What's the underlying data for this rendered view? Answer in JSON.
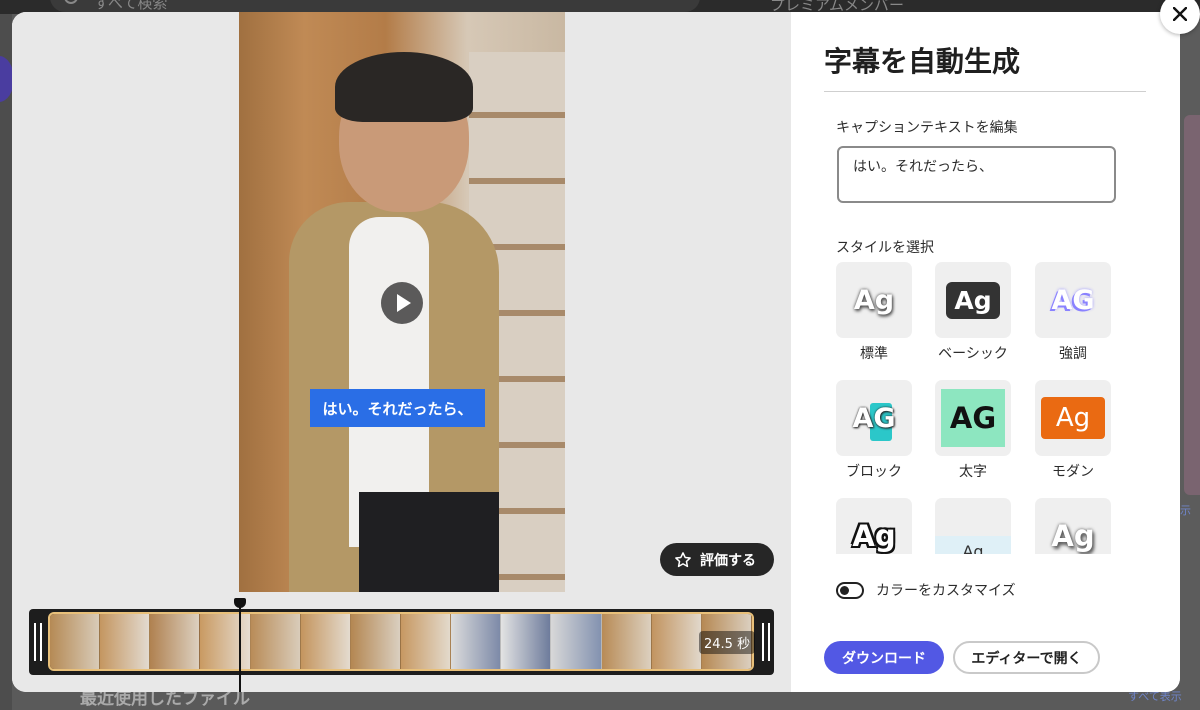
{
  "background": {
    "search_placeholder": "すべて検索",
    "premium_label": "プレミアムメンバー",
    "recent_files_heading": "最近使用したファイル",
    "show_all_link": "すべて表示",
    "side_link": "示"
  },
  "preview": {
    "caption_overlay": "はい。それだったら、",
    "rate_button": "評価する",
    "duration": "24.5 秒"
  },
  "panel": {
    "title": "字幕を自動生成",
    "edit_label": "キャプションテキストを編集",
    "caption_text": "はい。それだったら、",
    "style_label": "スタイルを選択",
    "styles": [
      {
        "name": "標準",
        "thumb": "Ag"
      },
      {
        "name": "ベーシック",
        "thumb": "Ag"
      },
      {
        "name": "強調",
        "thumb": "AG"
      },
      {
        "name": "ブロック",
        "thumb": "AG"
      },
      {
        "name": "太字",
        "thumb": "AG"
      },
      {
        "name": "モダン",
        "thumb": "Ag"
      },
      {
        "name": "",
        "thumb": "Ag"
      },
      {
        "name": "",
        "thumb": "Ag"
      },
      {
        "name": "",
        "thumb": "Ag"
      }
    ],
    "customize_color_label": "カラーをカスタマイズ",
    "download_button": "ダウンロード",
    "open_in_editor_button": "エディターで開く"
  },
  "colors": {
    "accent": "#5258e4",
    "caption_blue": "#2a6ee6",
    "modern_orange": "#ea6a12",
    "bold_mint": "#8de6c0",
    "block_teal": "#2bc7c9"
  }
}
